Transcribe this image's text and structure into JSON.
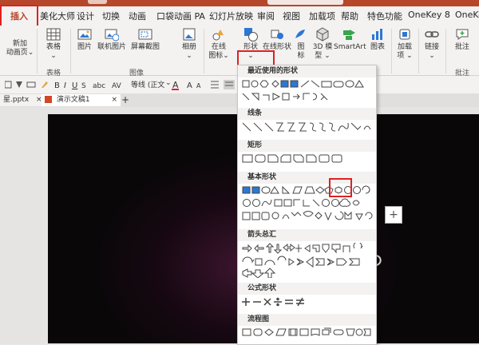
{
  "tabs": [
    {
      "label": "插入",
      "active": true
    },
    {
      "label": "美化大师"
    },
    {
      "label": "设计"
    },
    {
      "label": "切换"
    },
    {
      "label": "动画"
    },
    {
      "label": "口袋动画 PA"
    },
    {
      "label": "幻灯片放映"
    },
    {
      "label": "审阅"
    },
    {
      "label": "视图"
    },
    {
      "label": "加载项"
    },
    {
      "label": "帮助"
    },
    {
      "label": "特色功能"
    },
    {
      "label": "OneKey 8"
    },
    {
      "label": "OneKey"
    }
  ],
  "ribbon": {
    "new_slide": "新加\n动画页⌄",
    "table": "表格\n⌄",
    "picture": "图片",
    "online_picture": "联机图片",
    "screenshot": "屏幕截图",
    "album": "相册\n⌄",
    "group_table": "表格",
    "group_image": "图像",
    "shape_label_left": "在线\n图标⌄",
    "shapes": "形状\n⌄",
    "online_shapes": "在线形状",
    "icons": "图\n标",
    "model3d": "3D 模\n型 ⌄",
    "smartart": "SmartArt",
    "chart": "图表",
    "addins": "加载\n项 ⌄",
    "link": "链接\n⌄",
    "comment": "批注",
    "group_comment": "批注"
  },
  "format_bar": {
    "font_name": "等线 (正文",
    "font_size_hint": "⌄"
  },
  "doc_tabs": [
    {
      "label": "星.pptx",
      "close": "×"
    },
    {
      "label": "演示文稿1",
      "close": "×"
    },
    {
      "label": "+"
    }
  ],
  "slide": {
    "add_label": "+"
  },
  "dropdown": {
    "sections": [
      {
        "title": "最近使用的形状"
      },
      {
        "title": "线条"
      },
      {
        "title": "矩形"
      },
      {
        "title": "基本形状"
      },
      {
        "title": "箭头总汇"
      },
      {
        "title": "公式形状"
      },
      {
        "title": "流程图"
      }
    ]
  },
  "colors": {
    "accent": "#b7472a",
    "highlight": "#e02020",
    "shape_stroke": "#444444",
    "shape_fill_blue": "#2b78d4"
  }
}
